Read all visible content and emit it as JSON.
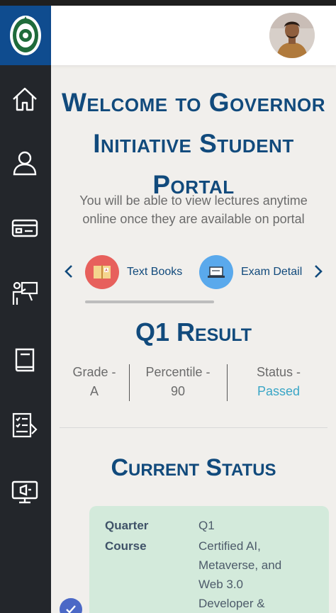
{
  "colors": {
    "primary": "#114a7c",
    "sidebar": "#23262b",
    "logo_bg": "#0f4c8f",
    "passed": "#3aa6c6",
    "card_bg": "#d3eadb",
    "text_books_icon_bg": "#e7605c",
    "exam_icon_bg": "#5aa9ec"
  },
  "sidebar": {
    "items": [
      {
        "icon": "home-icon"
      },
      {
        "icon": "user-icon"
      },
      {
        "icon": "card-icon"
      },
      {
        "icon": "teacher-board-icon"
      },
      {
        "icon": "book-icon"
      },
      {
        "icon": "assignment-icon"
      },
      {
        "icon": "presentation-icon"
      }
    ]
  },
  "welcome": {
    "line1": "Welcome to Governor",
    "line2": "Initiative Student",
    "line3": "Portal",
    "description": "You will be able to view lectures anytime online once they are available on portal"
  },
  "quick_links": [
    {
      "label": "Text Books",
      "icon": "text-books-icon"
    },
    {
      "label": "Exam Detail",
      "icon": "exam-detail-icon"
    }
  ],
  "result": {
    "title": "Q1 Result",
    "grade_label": "Grade -",
    "grade_value": "A",
    "percentile_label": "Percentile -",
    "percentile_value": "90",
    "status_label": "Status -",
    "status_value": "Passed"
  },
  "current_status": {
    "title": "Current Status",
    "quarter_label": "Quarter",
    "quarter_value": "Q1",
    "course_label": "Course",
    "course_line1": "Certified AI,",
    "course_line2": "Metaverse, and",
    "course_line3": "Web 3.0",
    "course_line4": "Developer &"
  }
}
